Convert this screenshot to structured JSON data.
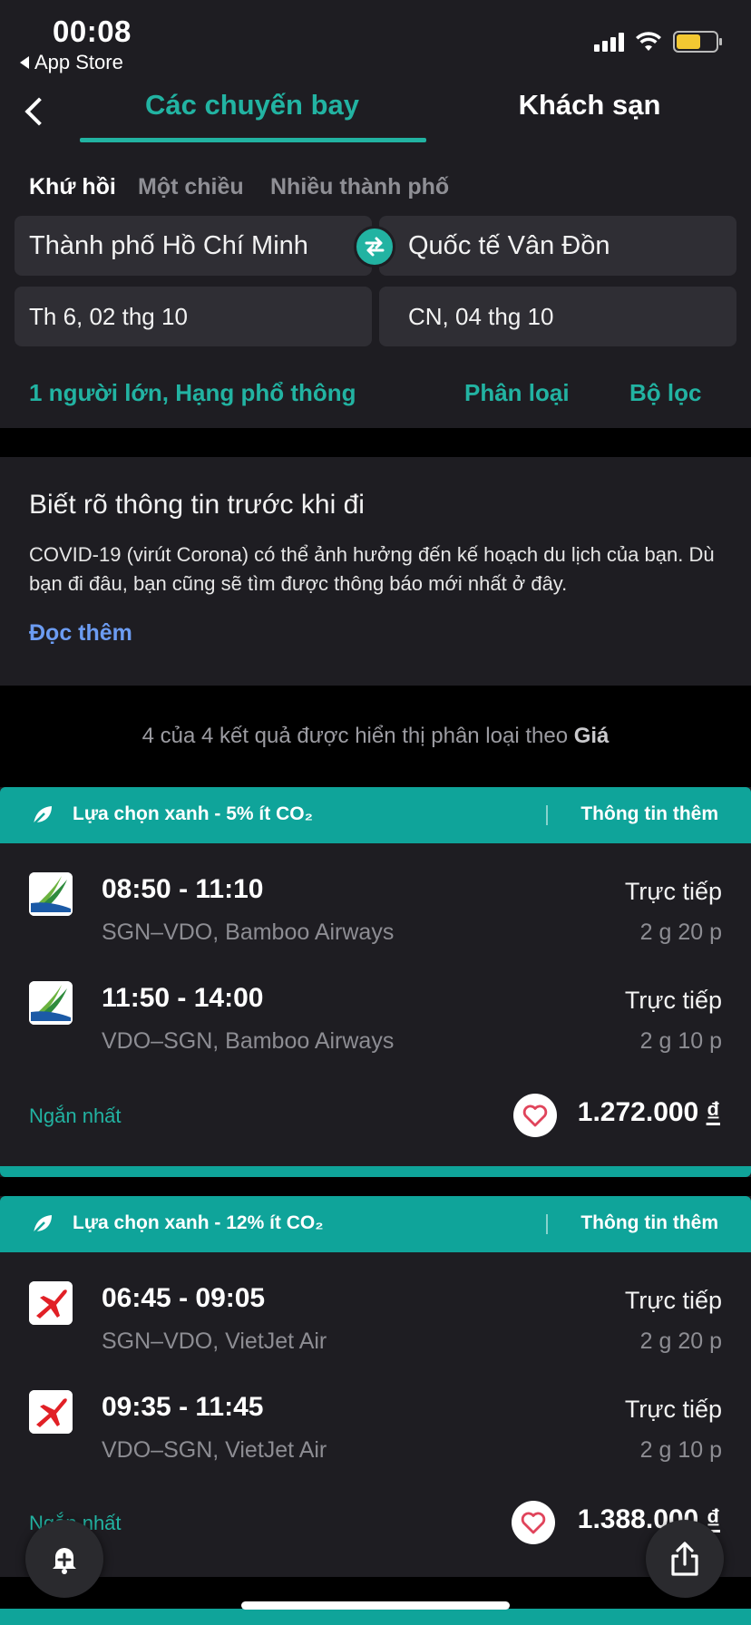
{
  "status_bar": {
    "time": "00:08",
    "back_app_label": "App Store",
    "battery_color": "#f3c832"
  },
  "tabs": {
    "flights": "Các chuyến bay",
    "hotels": "Khách sạn"
  },
  "trip_types": {
    "round_trip": "Khứ hồi",
    "one_way": "Một chiều",
    "multi_city": "Nhiều thành phố"
  },
  "search": {
    "origin": "Thành phố Hồ Chí Minh",
    "destination": "Quốc tế Vân Đồn",
    "depart_date": "Th 6, 02 thg 10",
    "return_date": "CN, 04 thg 10",
    "passengers": "1 người lớn, Hạng phổ thông",
    "sort_label": "Phân loại",
    "filter_label": "Bộ lọc"
  },
  "info": {
    "title": "Biết rõ thông tin trước khi đi",
    "body": "COVID-19 (virút Corona) có thể ảnh hưởng đến kế hoạch du lịch của bạn. Dù bạn đi đâu, bạn cũng sẽ tìm được thông báo mới nhất ở đây.",
    "link": "Đọc thêm"
  },
  "results": {
    "count_text": "4 của 4 kết quả được hiển thị phân loại theo",
    "sort_key": "Giá"
  },
  "accent_color": "#22b3a2",
  "cards": [
    {
      "green_label": "Lựa chọn xanh - 5% ít CO₂",
      "more_info": "Thông tin thêm",
      "legs": [
        {
          "time": "08:50 - 11:10",
          "route": "SGN–VDO, Bamboo Airways",
          "type": "Trực tiếp",
          "duration": "2 g 20 p",
          "logo": "bamboo-airways-logo"
        },
        {
          "time": "11:50 - 14:00",
          "route": "VDO–SGN, Bamboo Airways",
          "type": "Trực tiếp",
          "duration": "2 g 10 p",
          "logo": "bamboo-airways-logo"
        }
      ],
      "tag": "Ngắn nhất",
      "price": "1.272.000",
      "currency": "₫"
    },
    {
      "green_label": "Lựa chọn xanh - 12% ít CO₂",
      "more_info": "Thông tin thêm",
      "legs": [
        {
          "time": "06:45 - 09:05",
          "route": "SGN–VDO, VietJet Air",
          "type": "Trực tiếp",
          "duration": "2 g 20 p",
          "logo": "vietjet-logo"
        },
        {
          "time": "09:35 - 11:45",
          "route": "VDO–SGN, VietJet Air",
          "type": "Trực tiếp",
          "duration": "2 g 10 p",
          "logo": "vietjet-logo"
        }
      ],
      "tag": "Ngắn nhất",
      "price": "1.388.000",
      "currency": "₫"
    }
  ]
}
